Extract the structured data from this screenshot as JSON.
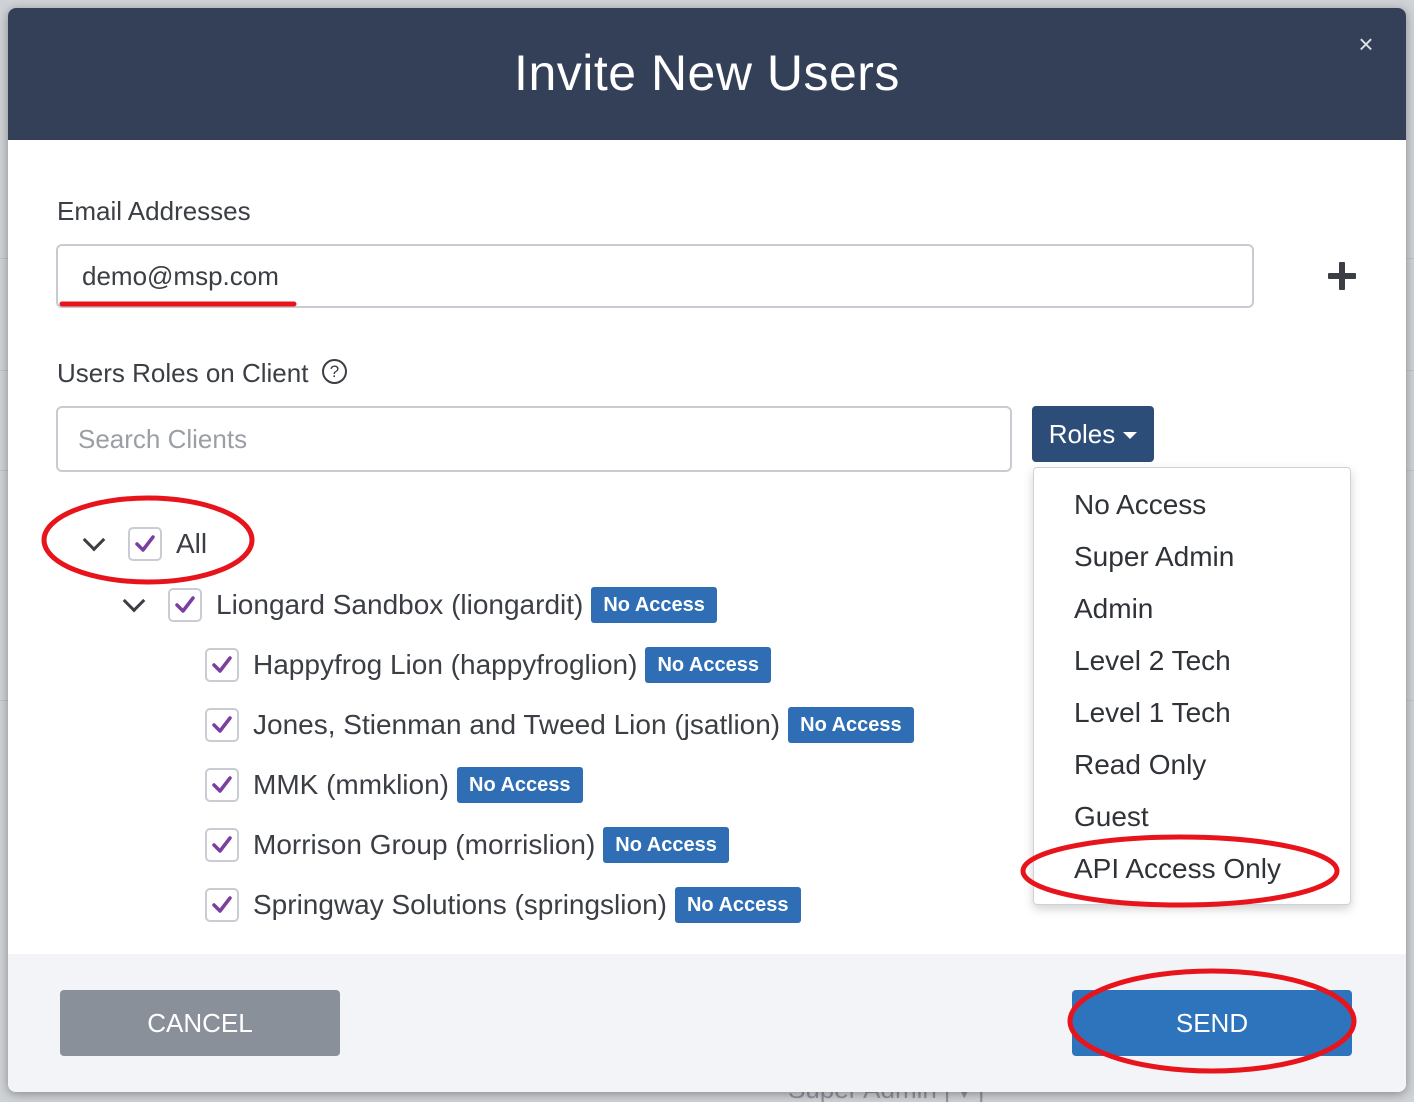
{
  "backdrop": {
    "footer_text": "Super Admin [▼]"
  },
  "modal": {
    "title": "Invite New Users",
    "close_label": "×"
  },
  "email": {
    "label": "Email Addresses",
    "value": "demo@msp.com"
  },
  "roles_section": {
    "label": "Users Roles on Client",
    "help_label": "?",
    "search_placeholder": "Search Clients",
    "roles_button_label": "Roles"
  },
  "roles_menu": {
    "items": [
      "No Access",
      "Super Admin",
      "Admin",
      "Level 2 Tech",
      "Level 1 Tech",
      "Read Only",
      "Guest",
      "API Access Only"
    ]
  },
  "tree": {
    "all_label": "All",
    "parent": {
      "label": "Liongard Sandbox (liongardit)",
      "role": "No Access"
    },
    "children": [
      {
        "label": "Happyfrog Lion (happyfroglion)",
        "role": "No Access"
      },
      {
        "label": "Jones, Stienman and Tweed Lion (jsatlion)",
        "role": "No Access"
      },
      {
        "label": "MMK (mmklion)",
        "role": "No Access"
      },
      {
        "label": "Morrison Group (morrislion)",
        "role": "No Access"
      },
      {
        "label": "Springway Solutions (springslion)",
        "role": "No Access"
      }
    ]
  },
  "footer": {
    "cancel_label": "CANCEL",
    "send_label": "SEND"
  },
  "colors": {
    "header": "#344058",
    "roles_button": "#2d4d79",
    "badge": "#2f6eb5",
    "send": "#2e74bd",
    "cancel": "#8a9099",
    "check": "#7b3fa0",
    "annotation": "#e8141c"
  }
}
